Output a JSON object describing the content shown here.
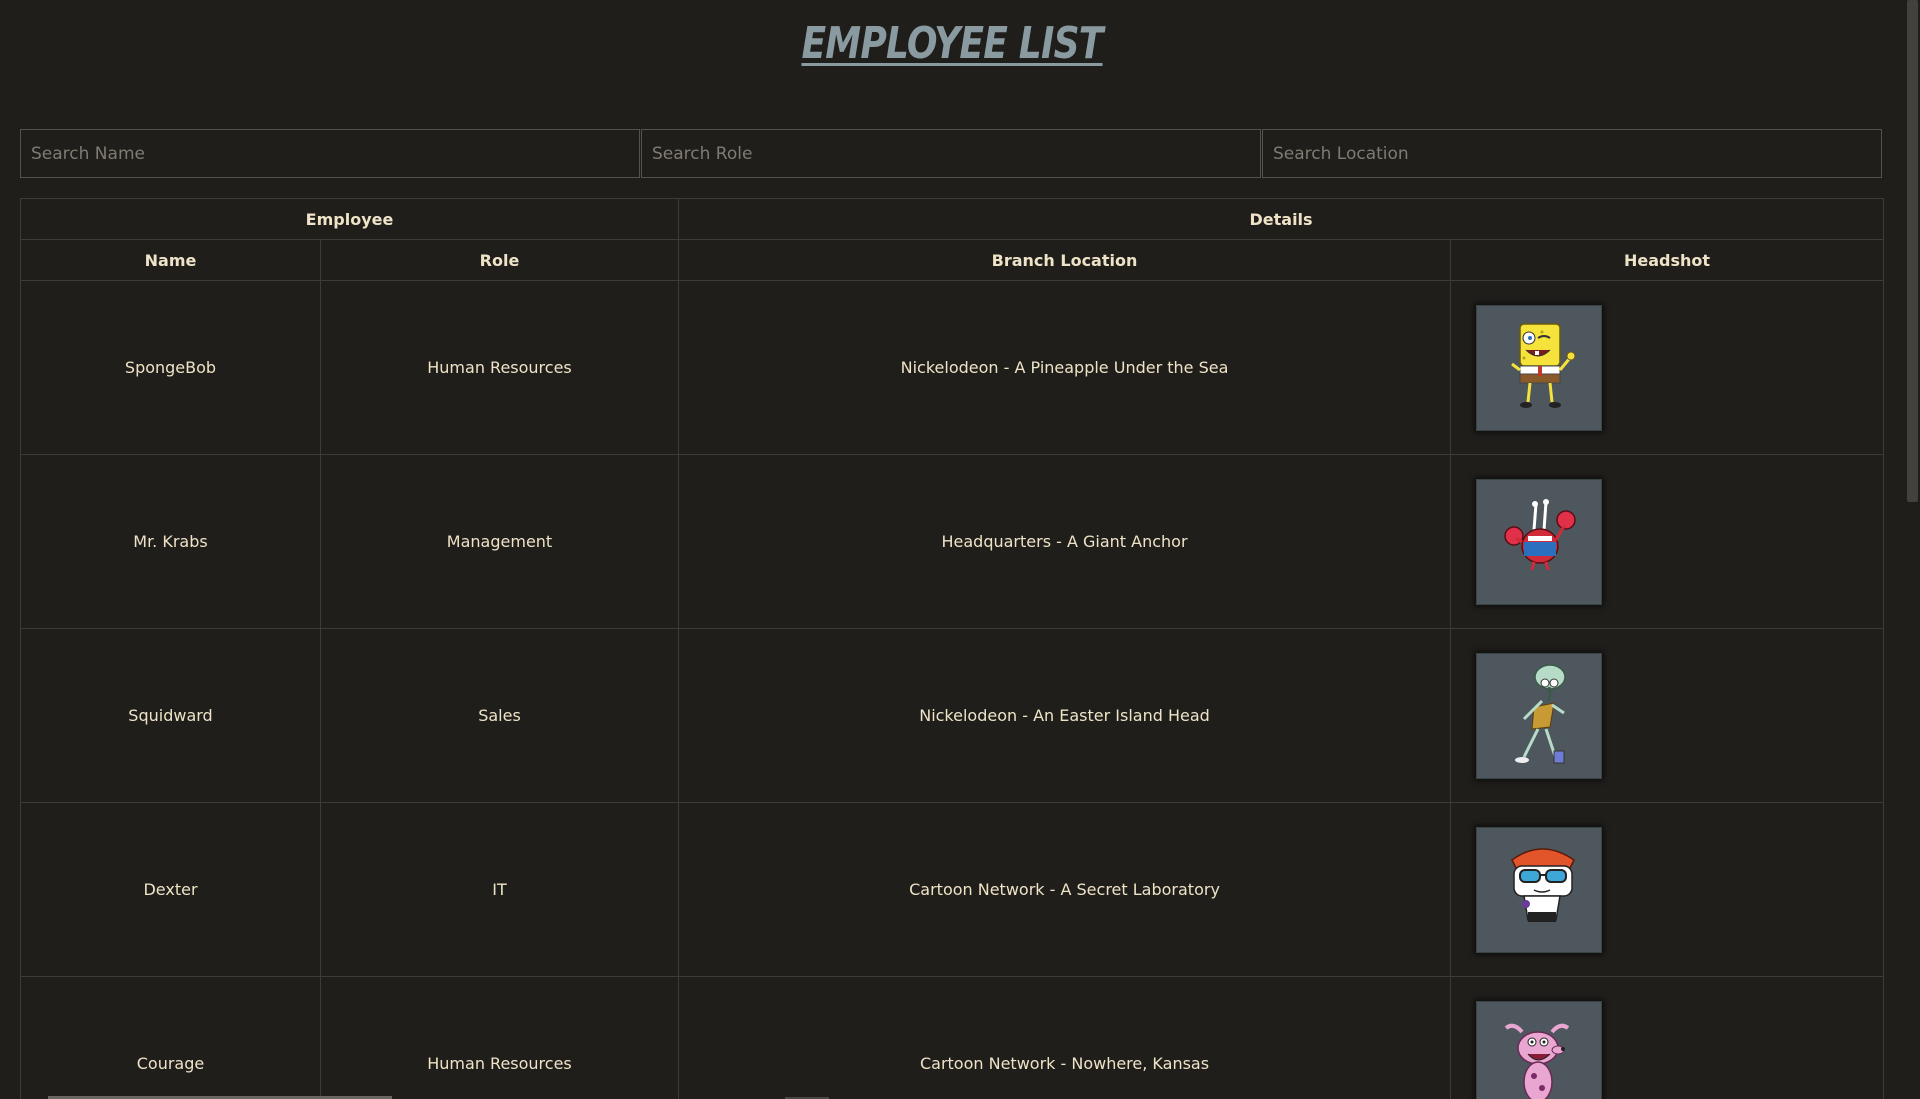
{
  "page_title": "EMPLOYEE LIST",
  "search": {
    "name_placeholder": "Search Name",
    "role_placeholder": "Search Role",
    "location_placeholder": "Search Location"
  },
  "table": {
    "group_headers": {
      "employee": "Employee",
      "details": "Details"
    },
    "columns": {
      "name": "Name",
      "role": "Role",
      "location": "Branch Location",
      "headshot": "Headshot"
    },
    "rows": [
      {
        "name": "SpongeBob",
        "role": "Human Resources",
        "location": "Nickelodeon - A Pineapple Under the Sea",
        "headshot_icon": "spongebob-icon"
      },
      {
        "name": "Mr. Krabs",
        "role": "Management",
        "location": "Headquarters - A Giant Anchor",
        "headshot_icon": "mr-krabs-icon"
      },
      {
        "name": "Squidward",
        "role": "Sales",
        "location": "Nickelodeon - An Easter Island Head",
        "headshot_icon": "squidward-icon"
      },
      {
        "name": "Dexter",
        "role": "IT",
        "location": "Cartoon Network - A Secret Laboratory",
        "headshot_icon": "dexter-icon"
      },
      {
        "name": "Courage",
        "role": "Human Resources",
        "location": "Cartoon Network - Nowhere, Kansas",
        "headshot_icon": "courage-icon"
      }
    ]
  },
  "colors": {
    "background": "#1f1e1b",
    "text": "#efe3c7",
    "title": "#8a9aa1",
    "headshot_bg": "#4e575d"
  }
}
